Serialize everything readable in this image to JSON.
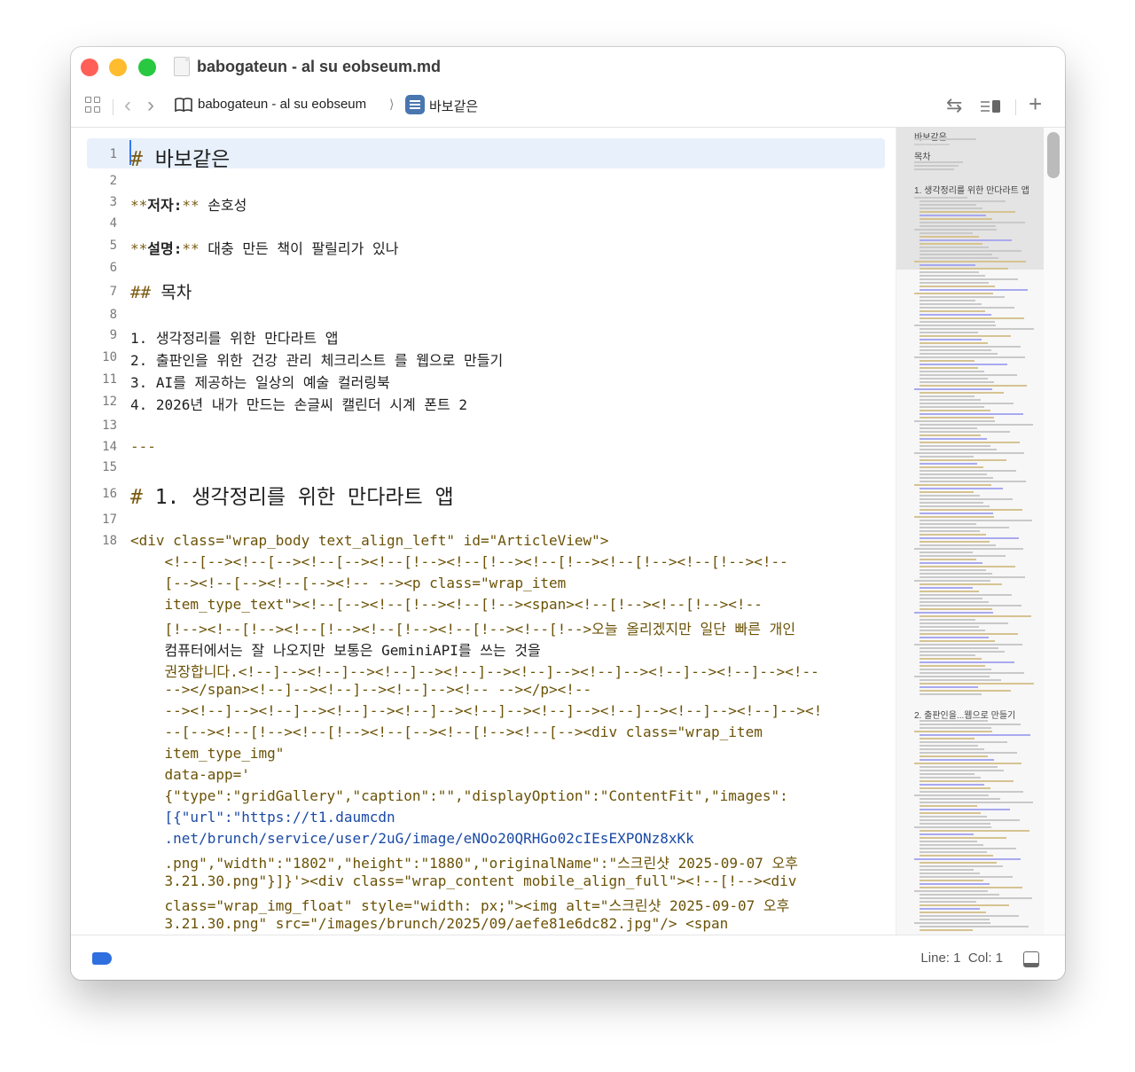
{
  "window": {
    "title": "babogateun - al su eobseum.md",
    "colors": {
      "close": "#ff5f57",
      "minimize": "#febc2e",
      "zoom": "#28c840",
      "accent": "#3478f6"
    }
  },
  "toolbar": {
    "icons": [
      "grid-icon",
      "back-icon",
      "forward-icon",
      "book-icon",
      "list-icon",
      "swap-icon",
      "outline-toggle-icon",
      "add-icon"
    ],
    "back": "‹",
    "forward": "›",
    "swap": "⇆",
    "add": "+",
    "crumb_separator": "⟩",
    "breadcrumb_book": "babogateun - al su eobseum",
    "breadcrumb_heading": "바보같은"
  },
  "editor": {
    "line_numbers": [
      "1",
      "2",
      "3",
      "4",
      "5",
      "6",
      "7",
      "8",
      "9",
      "10",
      "11",
      "12",
      "13",
      "14",
      "15",
      "16",
      "17",
      "18"
    ],
    "line1_mark": "#",
    "line1_text": " 바보같은",
    "line3_mark_open": "**",
    "line3_label": "저자:",
    "line3_mark_close": "**",
    "line3_value": " 손호성",
    "line5_mark_open": "**",
    "line5_label": "설명:",
    "line5_mark_close": "**",
    "line5_value": " 대충 만든 책이 팔릴리가 있나",
    "line7_mark": "##",
    "line7_text": " 목차",
    "toc": [
      "1. 생각정리를 위한 만다라트 앱",
      "2. 출판인을 위한 건강 관리 체크리스트 를 웹으로 만들기",
      "3. AI를 제공하는 일상의 예술 컬러링북",
      "4. 2026년 내가 만드는 손글씨 캘린더 시계 폰트 2"
    ],
    "hr": "---",
    "line16_mark": "#",
    "line16_text": " 1. 생각정리를 위한 만다라트 앱",
    "wrapped": [
      "<div class=\"wrap_body text_align_left\" id=\"ArticleView\">",
      "    <!--[--><!--[--><!--[--><!--[!--><!--[!--><!--[!--><!--[!--><!--[!--><!--",
      "    [--><!--[--><!--[--><!-- --><p class=\"wrap_item",
      "    item_type_text\"><!--[--><!--[!--><!--[!--><span><!--[!--><!--[!--><!--",
      "    [!--><!--[!--><!--[!--><!--[!--><!--[!--><!--[!-->오늘 올리겠지만 일단 빠른 개인",
      "    컴퓨터에서는 잘 나오지만 보통은 GeminiAPI를 쓰는 것을",
      "    권장합니다.<!--]--><!--]--><!--]--><!--]--><!--]--><!--]--><!--]--><!--]--><!--",
      "    --></span><!--]--><!--]--><!--]--><!-- --></p><!--",
      "    --><!--]--><!--]--><!--]--><!--]--><!--]--><!--]--><!--]--><!--]--><!--]--><!",
      "    --[--><!--[!--><!--[!--><!--[--><!--[!--><!--[--><div class=\"wrap_item",
      "    item_type_img\"",
      "    data-app='",
      "    {\"type\":\"gridGallery\",\"caption\":\"\",\"displayOption\":\"ContentFit\",\"images\":",
      "    [{\"url\":\"https://t1.daumcdn",
      "    .net/brunch/service/user/2uG/image/eNOo20QRHGo02cIEsEXPONz8xKk",
      "    .png\",\"width\":\"1802\",\"height\":\"1880\",\"originalName\":\"스크린샷 2025-09-07 오후",
      "    3.21.30.png\"}]}'><div class=\"wrap_content mobile_align_full\"><!--[!--><div",
      "    class=\"wrap_img_float\" style=\"width: px;\"><img alt=\"스크린샷 2025-09-07 오후",
      "    3.21.30.png\" src=\"/images/brunch/2025/09/aefe81e6dc82.jpg\"/> <span"
    ]
  },
  "minimap": {
    "title": "바보같은",
    "toc_heading": "목차",
    "section1": "1. 생각정리를 위한 만다라트 앱",
    "section2": "2. 출판인을...웹으로 만들기"
  },
  "status": {
    "line_label": "Line: 1",
    "col_label": "Col: 1",
    "tag_color": "#2f6fe0"
  }
}
